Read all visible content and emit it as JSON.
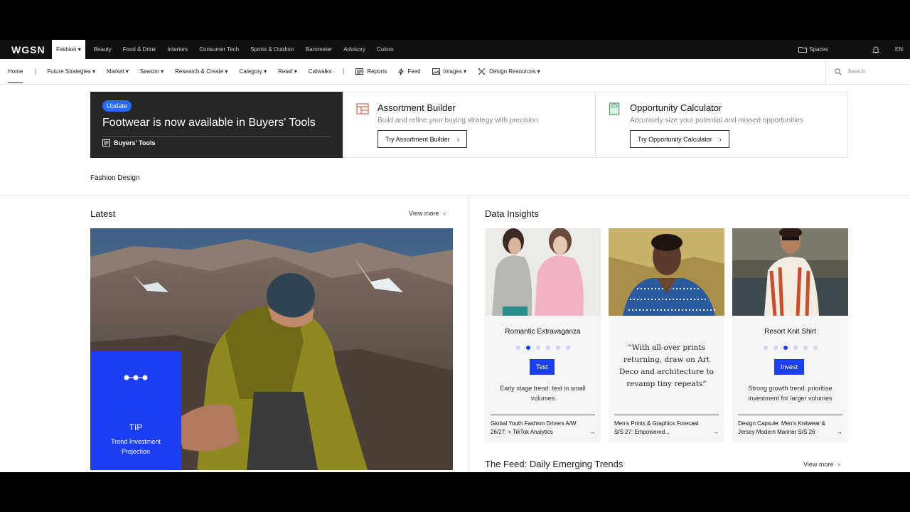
{
  "topnav": {
    "logo": "WGSN",
    "items": [
      "Fashion",
      "Beauty",
      "Food & Drink",
      "Interiors",
      "Consumer Tech",
      "Sports & Outdoor",
      "Barometer",
      "Advisory",
      "Coloro"
    ],
    "spaces": "Spaces",
    "lang": "EN"
  },
  "subnav": {
    "home": "Home",
    "items": [
      "Future Strategies",
      "Market",
      "Season",
      "Research & Create",
      "Category",
      "Retail",
      "Catwalks"
    ],
    "reports": "Reports",
    "feed": "Feed",
    "images": "Images",
    "design_resources": "Design Resources",
    "search_placeholder": "Search"
  },
  "banner": {
    "badge": "Update",
    "headline": "Footwear is now available in Buyers' Tools",
    "link": "Buyers' Tools",
    "tool1": {
      "title": "Assortment Builder",
      "desc": "Build and refine your buying strategy with precision",
      "cta": "Try Assortment Builder"
    },
    "tool2": {
      "title": "Opportunity Calculator",
      "desc": "Accurately size your potential and missed opportunities",
      "cta": "Try Opportunity Calculator"
    }
  },
  "section_label": "Fashion Design",
  "latest": {
    "title": "Latest",
    "view_more": "View more",
    "tip": {
      "label": "TIP",
      "sub": "Trend Investment Projection"
    }
  },
  "data_insights": {
    "title": "Data Insights",
    "cards": [
      {
        "title": "Romantic Extravaganza",
        "tag": "Test",
        "desc": "Early stage trend: test in small volumes",
        "foot": "Global Youth Fashion Drivers A/W 26/27: + TikTok Analytics",
        "active_dot": 2
      },
      {
        "quote": "“With all-over prints returning, draw on Art Deco and architecture to revamp tiny repeats”",
        "foot": "Men's Prints & Graphics Forecast S/S 27: Empowered..."
      },
      {
        "title": "Resort Knit Shirt",
        "tag": "Invest",
        "desc": "Strong growth trend: prioritise investment for larger volumes",
        "foot": "Design Capsule: Men's Knitwear & Jersey Modern Mariner S/S 26",
        "active_dot": 3
      }
    ]
  },
  "feed": {
    "title": "The Feed: Daily Emerging Trends",
    "view_more": "View more"
  },
  "colors": {
    "accent": "#1a3ef0",
    "badge": "#2b6af0",
    "dark": "#262626"
  }
}
